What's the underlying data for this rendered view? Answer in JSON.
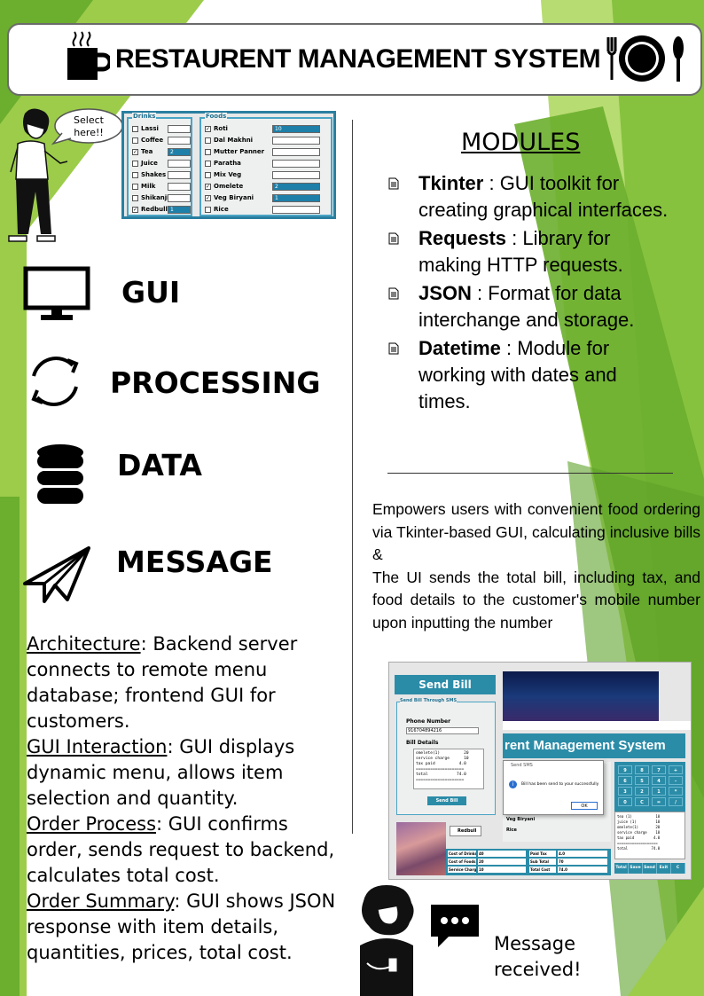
{
  "header": {
    "title": "RESTAURENT MANAGEMENT SYSTEM"
  },
  "speech_bubble": {
    "line1": "Select",
    "line2": "here!!"
  },
  "menu_screenshot": {
    "drinks_title": "Drinks",
    "foods_title": "Foods",
    "drinks": [
      {
        "label": "Lassi",
        "checked": false,
        "qty": ""
      },
      {
        "label": "Coffee",
        "checked": false,
        "qty": ""
      },
      {
        "label": "Tea",
        "checked": true,
        "qty": "2"
      },
      {
        "label": "Juice",
        "checked": false,
        "qty": ""
      },
      {
        "label": "Shakes",
        "checked": false,
        "qty": ""
      },
      {
        "label": "Milk",
        "checked": false,
        "qty": ""
      },
      {
        "label": "Shikanji",
        "checked": false,
        "qty": ""
      },
      {
        "label": "Redbull",
        "checked": true,
        "qty": "1"
      }
    ],
    "foods": [
      {
        "label": "Roti",
        "checked": true,
        "qty": "10"
      },
      {
        "label": "Dal Makhni",
        "checked": false,
        "qty": ""
      },
      {
        "label": "Mutter Panner",
        "checked": false,
        "qty": ""
      },
      {
        "label": "Paratha",
        "checked": false,
        "qty": ""
      },
      {
        "label": "Mix Veg",
        "checked": false,
        "qty": ""
      },
      {
        "label": "Omelete",
        "checked": true,
        "qty": "2"
      },
      {
        "label": "Veg Biryani",
        "checked": true,
        "qty": "1"
      },
      {
        "label": "Rice",
        "checked": false,
        "qty": ""
      }
    ]
  },
  "left_icons": {
    "gui": "GUI",
    "processing": "PROCESSING",
    "data": "DATA",
    "message": "MESSAGE"
  },
  "architecture": [
    {
      "heading": "Architecture",
      "text": ":  Backend server connects to remote menu database; frontend GUI for customers."
    },
    {
      "heading": "GUI Interaction",
      "text": ":  GUI displays dynamic menu, allows item selection and quantity."
    },
    {
      "heading": "Order Process",
      "text": ":  GUI confirms order, sends request to backend, calculates total cost."
    },
    {
      "heading": "Order Summary",
      "text": ": GUI shows JSON response with item details, quantities, prices, total cost."
    }
  ],
  "modules": {
    "title": "MODULES",
    "items": [
      {
        "name": "Tkinter",
        "desc": " : GUI toolkit for creating graphical interfaces."
      },
      {
        "name": "Requests",
        "desc": " : Library for making HTTP requests."
      },
      {
        "name": "JSON",
        "desc": " : Format for data interchange and storage."
      },
      {
        "name": "Datetime",
        "desc": " : Module for working with dates and times."
      }
    ]
  },
  "description": {
    "line1": "Empowers users with convenient food ordering via Tkinter-based GUI, calculating inclusive bills &",
    "line2": "The UI sends the total bill, including tax, and food details to the customer's mobile number upon inputting the number"
  },
  "bill_screenshot": {
    "send_bill": "Send Bill",
    "send_sms_title": "Send Bill Through SMS",
    "phone_label": "Phone Number",
    "phone_value": "916704894216",
    "bill_details_label": "Bill Details",
    "receipt_lines": [
      "omelete(1)          20",
      "service charge      10",
      "tax paid          4.0",
      "====================",
      "total            74.0",
      "===================="
    ],
    "send_button": "Send Bill",
    "app_title": "rent Management System",
    "dialog_title": "Send SMS",
    "dialog_msg": "Bill has been send to your successfully",
    "dialog_ok": "OK",
    "redbull": "Redbull",
    "veg_biryani": "Veg Biryani",
    "rice": "Rice",
    "calc_keys": [
      "9",
      "8",
      "7",
      "+",
      "6",
      "5",
      "4",
      "-",
      "3",
      "2",
      "1",
      "*",
      "0",
      "C",
      "=",
      "/"
    ],
    "right_receipt": [
      "tea (1)           10",
      "juice (1)         10",
      "omelete(1)        20",
      "service charge    10",
      "tax paid         4.0",
      "===================",
      "total           74.0"
    ],
    "cost_rows": [
      {
        "label": "Cost of Drinks",
        "value": "40",
        "label2": "Paid Tax",
        "value2": "4.0"
      },
      {
        "label": "Cost of Foods",
        "value": "20",
        "label2": "Sub Total",
        "value2": "70"
      },
      {
        "label": "Service Charge",
        "value": "10",
        "label2": "Total Cost",
        "value2": "74.0"
      }
    ],
    "bottom_buttons": [
      "Total",
      "Save",
      "Send",
      "Exit",
      "C"
    ]
  },
  "message_received": {
    "line1": "Message",
    "line2": "received!"
  },
  "colors": {
    "green_light": "#b3d86a",
    "green_dark": "#6cae2e",
    "teal": "#2b8ca8"
  }
}
